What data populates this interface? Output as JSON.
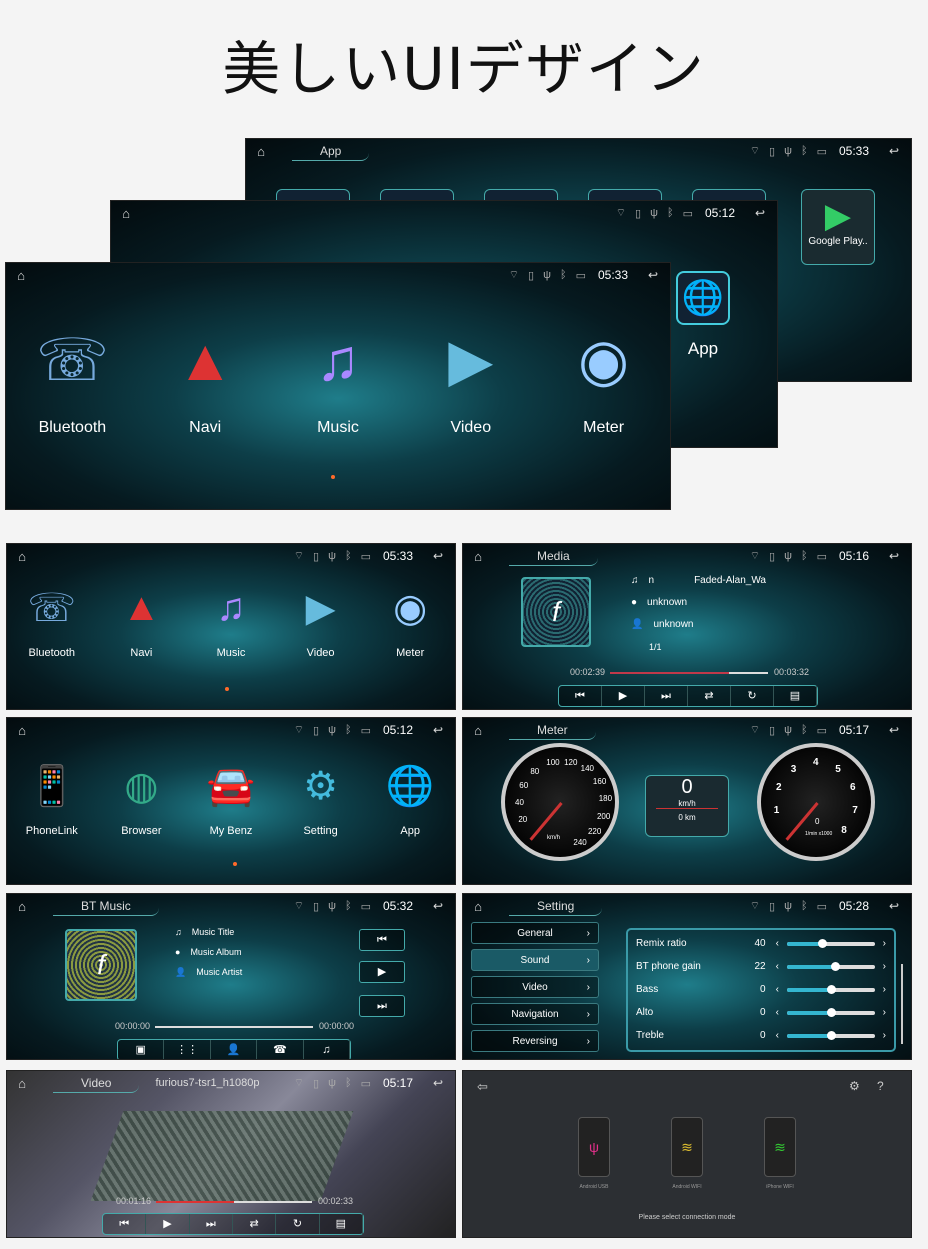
{
  "headline": "美しいUIデザイン",
  "colors": {
    "accent": "#34b6d0",
    "progress": "#c0394a",
    "background": "#0d3e48"
  },
  "hero": {
    "back": {
      "title": "App",
      "time": "05:33",
      "apps": [
        "",
        "",
        "",
        "",
        ""
      ],
      "google_play": "Google Play.."
    },
    "middle": {
      "time": "05:12",
      "app_label": "App"
    },
    "front": {
      "time": "05:33",
      "apps": [
        {
          "label": "Bluetooth",
          "icon": "bluetooth-phone-icon"
        },
        {
          "label": "Navi",
          "icon": "navigation-arrow-icon"
        },
        {
          "label": "Music",
          "icon": "music-note-icon"
        },
        {
          "label": "Video",
          "icon": "clapperboard-icon"
        },
        {
          "label": "Meter",
          "icon": "speedometer-icon"
        }
      ]
    }
  },
  "home1": {
    "time": "05:33",
    "apps": [
      {
        "label": "Bluetooth"
      },
      {
        "label": "Navi"
      },
      {
        "label": "Music"
      },
      {
        "label": "Video"
      },
      {
        "label": "Meter"
      }
    ]
  },
  "home2": {
    "time": "05:12",
    "apps": [
      {
        "label": "PhoneLink"
      },
      {
        "label": "Browser"
      },
      {
        "label": "My Benz"
      },
      {
        "label": "Setting"
      },
      {
        "label": "App"
      }
    ]
  },
  "media": {
    "title": "Media",
    "time": "05:16",
    "track": "n",
    "track_name": "Faded-Alan_Wa",
    "album": "unknown",
    "artist": "unknown",
    "index": "1/1",
    "elapsed": "00:02:39",
    "duration": "00:03:32",
    "progress": 0.75
  },
  "meter": {
    "title": "Meter",
    "time": "05:17",
    "speed_ticks": [
      "20",
      "40",
      "60",
      "80",
      "100",
      "120",
      "140",
      "160",
      "180",
      "200",
      "220",
      "240"
    ],
    "speed_unit": "km/h",
    "speed": "0",
    "center_unit": "km/h",
    "odometer": "0 km",
    "rpm_ticks": [
      "1",
      "2",
      "3",
      "4",
      "5",
      "6",
      "7",
      "8"
    ],
    "rpm_value": "0",
    "rpm_unit": "1/min x1000"
  },
  "bt_music": {
    "title": "BT Music",
    "time": "05:32",
    "music_title": "Music Title",
    "music_album": "Music Album",
    "music_artist": "Music Artist",
    "elapsed": "00:00:00",
    "duration": "00:00:00"
  },
  "setting": {
    "title": "Setting",
    "time": "05:28",
    "menu": [
      "General",
      "Sound",
      "Video",
      "Navigation",
      "Reversing"
    ],
    "selected": "Sound",
    "rows": [
      {
        "name": "Remix ratio",
        "value": "40",
        "level": 0.4
      },
      {
        "name": "BT phone gain",
        "value": "22",
        "level": 0.55
      },
      {
        "name": "Bass",
        "value": "0",
        "level": 0.5
      },
      {
        "name": "Alto",
        "value": "0",
        "level": 0.5
      },
      {
        "name": "Treble",
        "value": "0",
        "level": 0.5
      }
    ]
  },
  "video": {
    "title": "Video",
    "file": "furious7-tsr1_h1080p",
    "time": "05:17",
    "elapsed": "00:01:16",
    "duration": "00:02:33",
    "progress": 0.5
  },
  "phonelink": {
    "modes": [
      "Android USB",
      "Android WIFI",
      "iPhone WIFI"
    ],
    "prompt": "Please select connection mode"
  }
}
